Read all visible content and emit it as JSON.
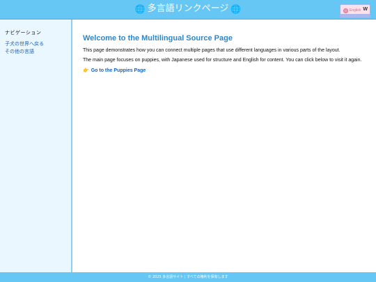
{
  "header": {
    "title": "多言語リンクページ",
    "language_button": {
      "label": "English",
      "logo": "W"
    }
  },
  "sidebar": {
    "heading": "ナビゲーション",
    "links": [
      {
        "label": "子犬の世界へ戻る"
      },
      {
        "label": "その他の言語"
      }
    ]
  },
  "main": {
    "heading": "Welcome to the Multilingual Source Page",
    "paragraphs": [
      "This page demonstrates how you can connect multiple pages that use different languages in various parts of the layout.",
      "The main page focuses on puppies, with Japanese used for structure and English for content. You can click below to visit it again."
    ],
    "link_label": "Go to the Puppies Page"
  },
  "footer": {
    "text": "© 2025 多言語サイト | すべての権利を保有します"
  },
  "colors": {
    "header_bg": "#66c6f4",
    "sidebar_bg": "#eaf7fe",
    "heading": "#2d86c9",
    "link": "#1a63b8"
  },
  "icons": {
    "title_left": "globe-icon",
    "title_right": "globe-icon",
    "link_hand": "pointing-hand-icon",
    "language_flag": "flag-icon"
  }
}
